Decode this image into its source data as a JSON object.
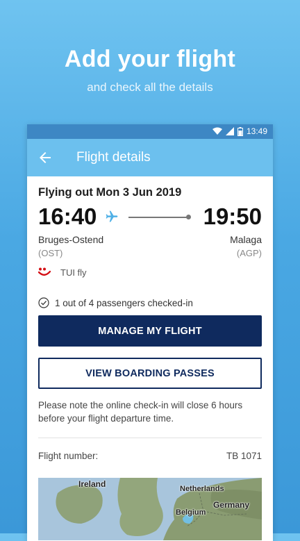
{
  "promo": {
    "title": "Add your flight",
    "subtitle": "and check all the details"
  },
  "status_bar": {
    "time": "13:49",
    "icons": [
      "wifi-icon",
      "signal-icon",
      "battery-icon"
    ]
  },
  "toolbar": {
    "back_icon": "arrow-left-icon",
    "title": "Flight details"
  },
  "flight": {
    "heading": "Flying out Mon 3 Jun 2019",
    "departure_time": "16:40",
    "arrival_time": "19:50",
    "departure_airport": "Bruges-Ostend",
    "departure_code": "(OST)",
    "arrival_airport": "Malaga",
    "arrival_code": "(AGP)",
    "carrier": "TUI fly",
    "checkin_status": "1 out of 4 passengers checked-in"
  },
  "actions": {
    "manage_label": "MANAGE MY FLIGHT",
    "boarding_label": "VIEW BOARDING PASSES"
  },
  "note": "Please note the online check-in will close 6 hours before your flight departure time.",
  "details": {
    "flight_number_label": "Flight number:",
    "flight_number_value": "TB 1071"
  },
  "map": {
    "labels": [
      "Ireland",
      "Netherlands",
      "Germany",
      "Belgium"
    ]
  },
  "colors": {
    "accent_blue": "#6cc0ee",
    "status_blue": "#3d87c4",
    "navy": "#0f2a5e",
    "tui_red": "#d40e14"
  }
}
